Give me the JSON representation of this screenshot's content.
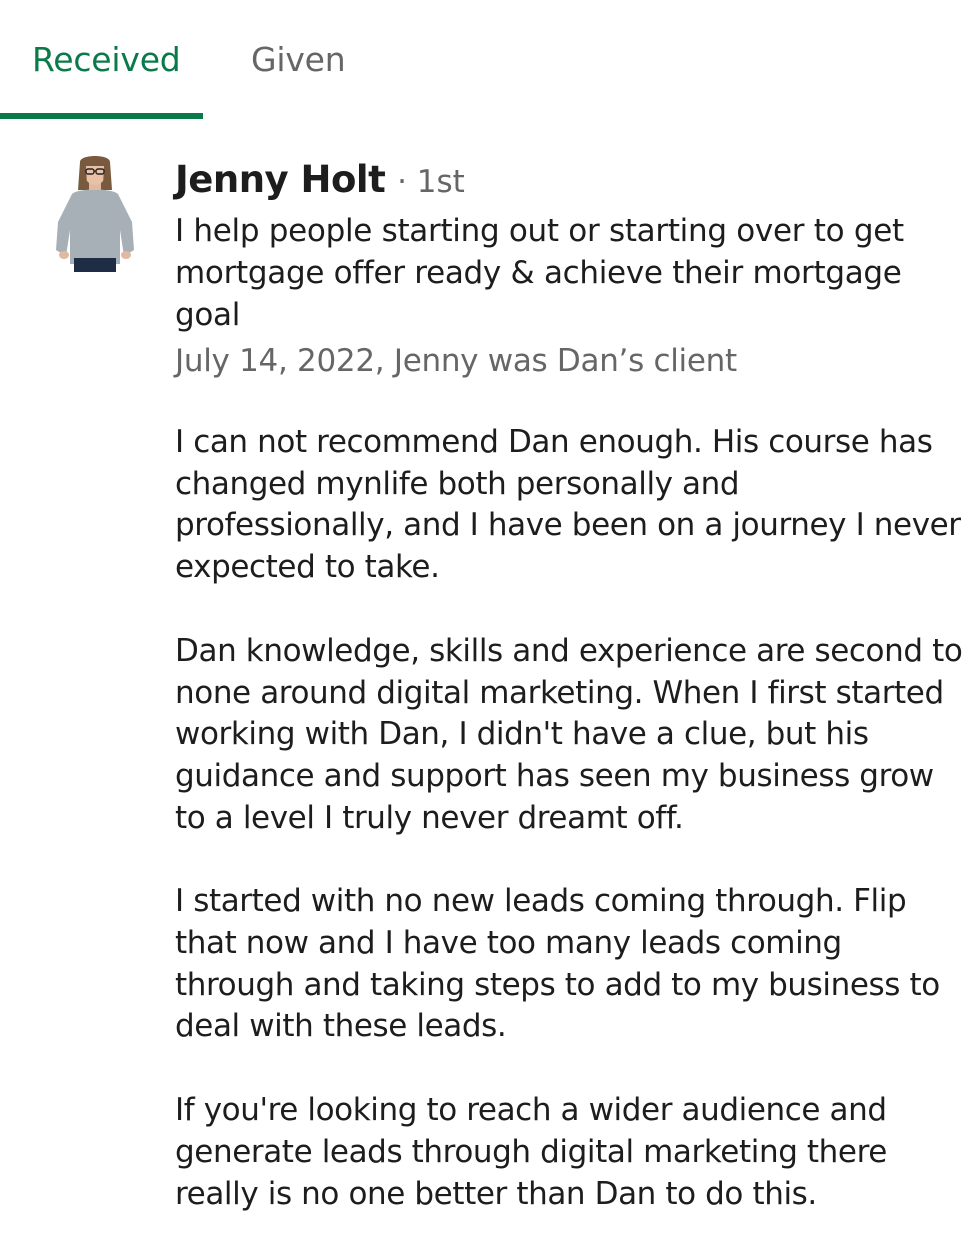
{
  "tabs": {
    "received_label": "Received",
    "given_label": "Given",
    "active": "Received",
    "accent_color": "#0a7a4a"
  },
  "recommendation": {
    "author_name": "Jenny Holt",
    "connection_degree": "· 1st",
    "headline": "I help people starting out or starting over to get mortgage offer ready & achieve their mortgage goal",
    "meta": "July 14, 2022, Jenny was Dan’s client",
    "paragraphs": [
      "I can not recommend Dan enough. His course has changed mynlife both personally and professionally, and I have been on a journey I never expected to take.",
      "Dan knowledge, skills and experience are second to none around digital marketing. When I first started working with Dan, I didn't have a clue, but his guidance and support has seen my business grow to a level I truly never dreamt off.",
      "I started with no new leads coming through. Flip that now and I have too many leads coming through and taking steps to add to my business to deal with these leads.",
      "If you're looking to reach a wider audience and generate leads through digital marketing there really is no one better than Dan to do this."
    ]
  }
}
